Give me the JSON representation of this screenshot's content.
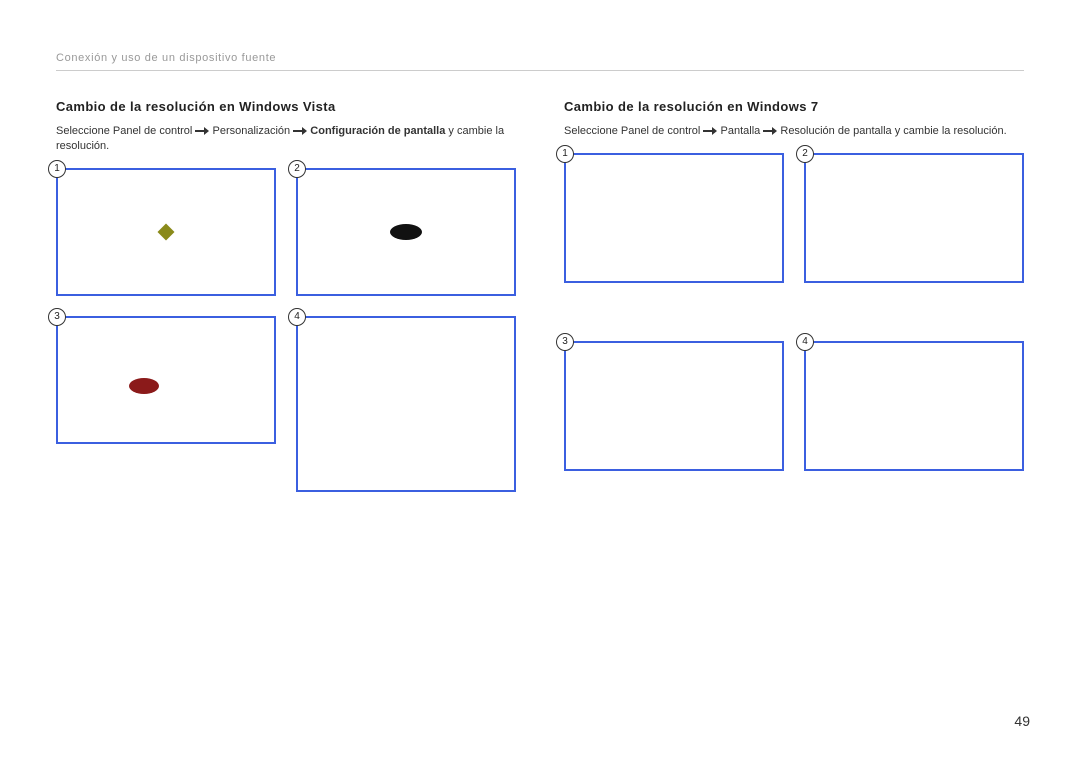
{
  "header": {
    "section": "Conexión y uso de un dispositivo fuente"
  },
  "left": {
    "heading": "Cambio de la resolución en Windows Vista",
    "desc_pre": "Seleccione Panel de control  ",
    "desc_step2": "  Personalización  ",
    "desc_bold": "  Configuración de pantalla",
    "desc_post": " y cambie la resolución.",
    "badges": {
      "b1": "1",
      "b2": "2",
      "b3": "3",
      "b4": "4"
    }
  },
  "right": {
    "heading": "Cambio de la resolución en Windows 7",
    "desc_pre": "Seleccione Panel de control  ",
    "desc_step2": "  Pantalla  ",
    "desc_step3": "  Resolución de pantalla",
    "desc_post": " y cambie la resolución.",
    "badges": {
      "b1": "1",
      "b2": "2",
      "b3": "3",
      "b4": "4"
    }
  },
  "pageNumber": "49"
}
